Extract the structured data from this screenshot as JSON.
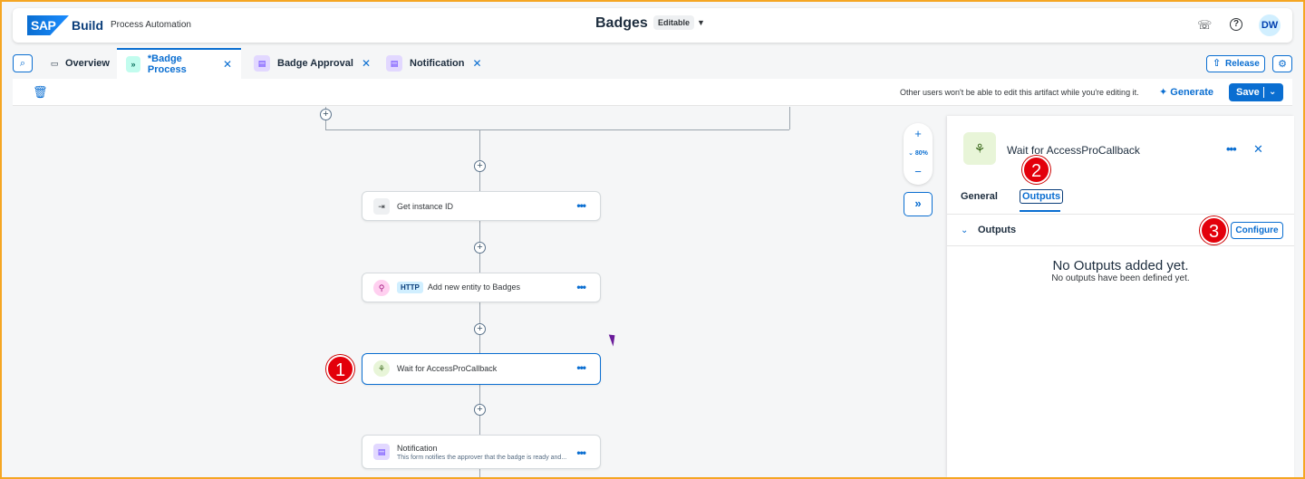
{
  "shell": {
    "sap_logo": "SAP",
    "brand": "Build",
    "product": "Process Automation",
    "doc_title": "Badges",
    "editable": "Editable",
    "avatar_initials": "DW"
  },
  "tabs": [
    {
      "label": "Overview"
    },
    {
      "label": "*Badge Process"
    },
    {
      "label": "Badge Approval"
    },
    {
      "label": "Notification"
    }
  ],
  "release_label": "Release",
  "toolbar": {
    "notice": "Other users won't be able to edit this artifact while you're editing it.",
    "generate_label": "Generate",
    "save_label": "Save"
  },
  "zoom": {
    "level": "80%"
  },
  "nodes": [
    {
      "label": "Get instance ID"
    },
    {
      "tag": "HTTP",
      "label": "Add new entity to Badges"
    },
    {
      "label": "Wait for AccessProCallback"
    },
    {
      "label": "Notification",
      "sub": "This form notifies the approver that the badge is ready and..."
    }
  ],
  "markers": [
    "1",
    "2",
    "3"
  ],
  "panel": {
    "title": "Wait for AccessProCallback",
    "tabs": [
      "General",
      "Outputs"
    ],
    "section_title": "Outputs",
    "configure_label": "Configure",
    "empty_title": "No Outputs added yet.",
    "empty_sub": "No outputs have been defined yet."
  }
}
